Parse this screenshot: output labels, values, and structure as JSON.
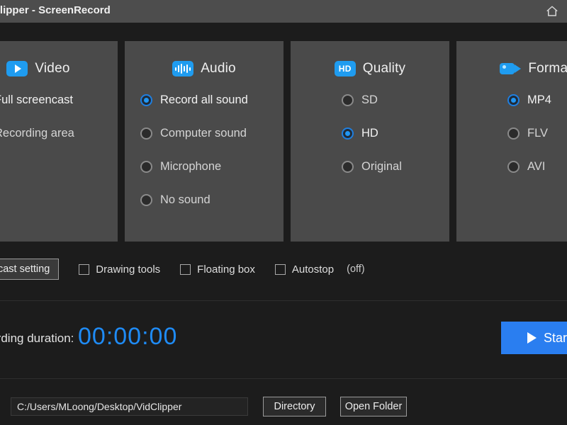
{
  "window": {
    "title": "VidClipper - ScreenRecord",
    "home_icon": "home-icon"
  },
  "panels": [
    {
      "key": "video",
      "title": "Video",
      "icon": "play-video-icon",
      "options": [
        {
          "label": "Full screencast",
          "selected": true
        },
        {
          "label": "Recording area",
          "selected": false
        }
      ]
    },
    {
      "key": "audio",
      "title": "Audio",
      "icon": "audio-waveform-icon",
      "options": [
        {
          "label": "Record all sound",
          "selected": true
        },
        {
          "label": "Computer sound",
          "selected": false
        },
        {
          "label": "Microphone",
          "selected": false
        },
        {
          "label": "No sound",
          "selected": false
        }
      ]
    },
    {
      "key": "quality",
      "title": "Quality",
      "icon": "hd-badge-icon",
      "options": [
        {
          "label": "SD",
          "selected": false
        },
        {
          "label": "HD",
          "selected": true
        },
        {
          "label": "Original",
          "selected": false
        }
      ]
    },
    {
      "key": "format",
      "title": "Format",
      "icon": "camcorder-icon",
      "options": [
        {
          "label": "MP4",
          "selected": true
        },
        {
          "label": "FLV",
          "selected": false
        },
        {
          "label": "AVI",
          "selected": false
        }
      ]
    }
  ],
  "toolbar": {
    "screencast_setting_label": "Screencast setting",
    "checkboxes": [
      {
        "label": "Drawing tools",
        "checked": false,
        "suffix": ""
      },
      {
        "label": "Floating box",
        "checked": false,
        "suffix": ""
      },
      {
        "label": "Autostop",
        "checked": false,
        "suffix": "(off)"
      }
    ]
  },
  "recording": {
    "duration_label": "Recording duration:",
    "duration_value": "00:00:00",
    "start_label": "Start",
    "start_icon": "play-icon"
  },
  "output": {
    "path_value": "C:/Users/MLoong/Desktop/VidClipper",
    "path_placeholder": "C:/Users/MLoong/Desktop/VidClipper",
    "directory_label": "Directory",
    "open_folder_label": "Open Folder"
  },
  "colors": {
    "accent": "#1f9cf0",
    "start_button": "#2a7ef0",
    "timer": "#1f8bf5",
    "panel_bg": "#4a4a4a",
    "app_bg": "#1c1c1c",
    "titlebar_bg": "#4d4d4d"
  }
}
